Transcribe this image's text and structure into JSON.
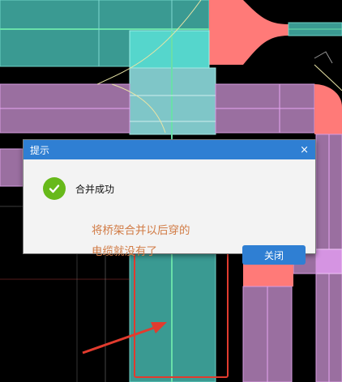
{
  "dialog": {
    "title": "提示",
    "close_glyph": "×",
    "message": "合并成功",
    "button_label": "关闭",
    "icon": "check-circle-icon"
  },
  "annotation": {
    "line1": "将桥架合并以后穿的",
    "line2": "电缆就没有了"
  },
  "colors": {
    "cable_tray_teal": "#3a9a92",
    "cable_tray_purple": "#9a6fa0",
    "fitting_salmon": "#ff7a78",
    "dialog_accent": "#2f7fd3",
    "success_green": "#67b91a",
    "annotation_red": "#e23b2e",
    "annotation_text": "#d17b45"
  }
}
